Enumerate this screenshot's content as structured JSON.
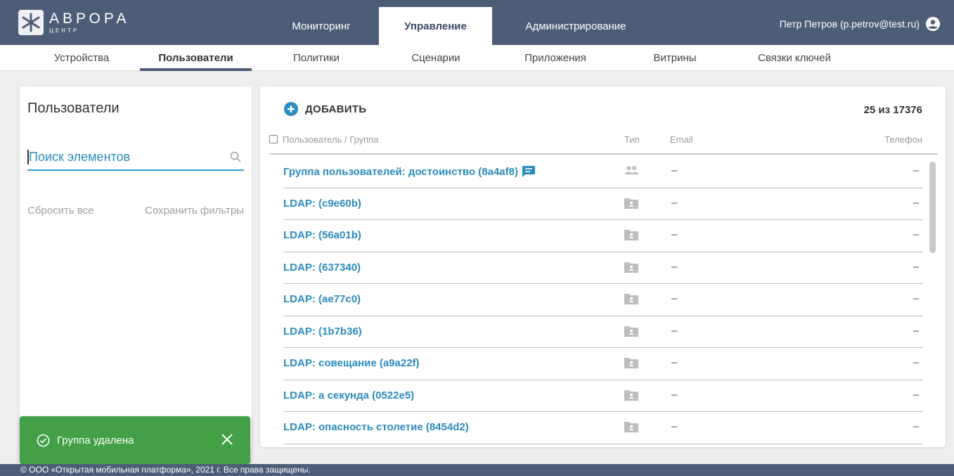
{
  "header": {
    "logo": {
      "name": "АВРОРА",
      "sub": "ЦЕНТР"
    },
    "tabs": [
      {
        "label": "Мониторинг",
        "active": false
      },
      {
        "label": "Управление",
        "active": true
      },
      {
        "label": "Администрирование",
        "active": false
      }
    ],
    "user": "Петр Петров (p.petrov@test.ru)",
    "colors": {
      "bar": "#4e5d77",
      "link": "#2a8bbd",
      "success": "#43a047"
    }
  },
  "subnav": {
    "tabs": [
      {
        "label": "Устройства",
        "active": false
      },
      {
        "label": "Пользователи",
        "active": true
      },
      {
        "label": "Политики",
        "active": false
      },
      {
        "label": "Сценарии",
        "active": false
      },
      {
        "label": "Приложения",
        "active": false
      },
      {
        "label": "Витрины",
        "active": false
      },
      {
        "label": "Связки ключей",
        "active": false
      }
    ]
  },
  "left": {
    "title": "Пользователи",
    "search_value": "Поиск элементов",
    "reset_label": "Сбросить все",
    "save_label": "Сохранить фильтры"
  },
  "main": {
    "add_label": "ДОБАВИТЬ",
    "count": "25 из 17376",
    "columns": {
      "user": "Пользователь / Группа",
      "type": "Тип",
      "email": "Email",
      "phone": "Телефон"
    },
    "rows": [
      {
        "name": "Группа пользователей: достоинство (8a4af8)",
        "type": "group-icon",
        "email": "–",
        "phone": "–",
        "comment": true
      },
      {
        "name": "LDAP: (c9e60b)",
        "type": "ldap-folder-icon",
        "email": "–",
        "phone": "–"
      },
      {
        "name": "LDAP: (56a01b)",
        "type": "ldap-folder-icon",
        "email": "–",
        "phone": "–"
      },
      {
        "name": "LDAP: (637340)",
        "type": "ldap-folder-icon",
        "email": "–",
        "phone": "–"
      },
      {
        "name": "LDAP: (ae77c0)",
        "type": "ldap-folder-icon",
        "email": "–",
        "phone": "–"
      },
      {
        "name": "LDAP: (1b7b36)",
        "type": "ldap-folder-icon",
        "email": "–",
        "phone": "–"
      },
      {
        "name": "LDAP: совещание (a9a22f)",
        "type": "ldap-folder-icon",
        "email": "–",
        "phone": "–"
      },
      {
        "name": "LDAP: а секунда (0522e5)",
        "type": "ldap-folder-icon",
        "email": "–",
        "phone": "–"
      },
      {
        "name": "LDAP: опасность столетие (8454d2)",
        "type": "ldap-folder-icon",
        "email": "–",
        "phone": "–"
      }
    ]
  },
  "toast": {
    "text": "Группа удалена"
  },
  "footer": {
    "text": "© ООО «Открытая мобильная платформа», 2021 г. Все права защищены."
  }
}
